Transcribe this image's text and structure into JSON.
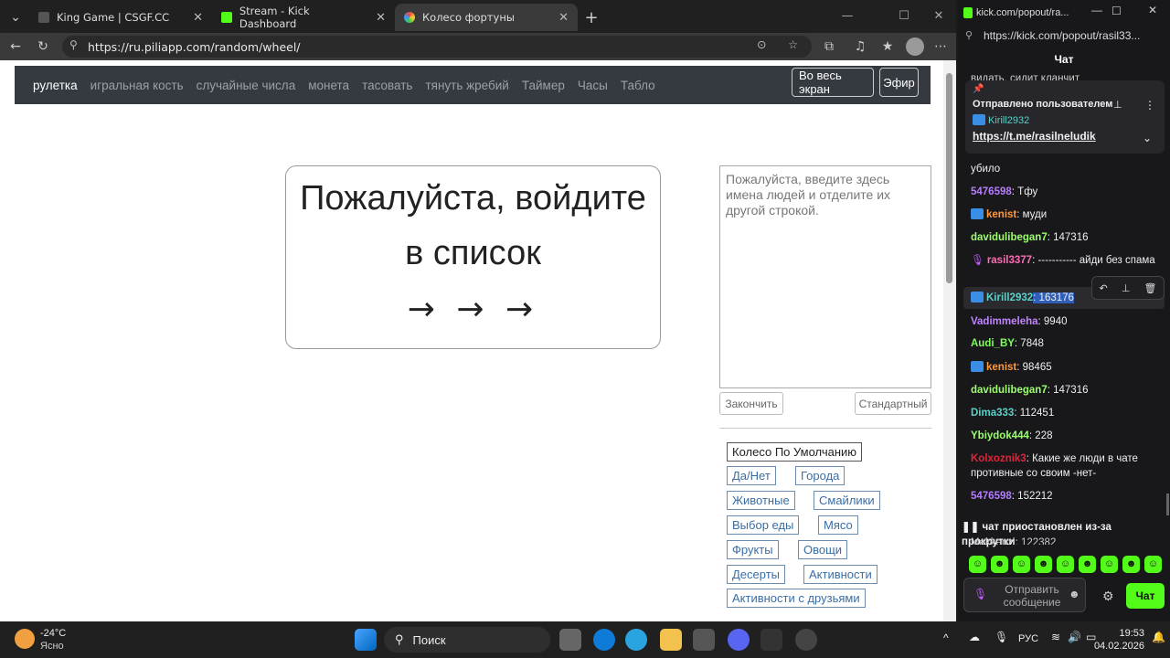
{
  "browser": {
    "tabs": [
      {
        "title": "King Game | CSGF.CC"
      },
      {
        "title": "Stream - Kick Dashboard"
      },
      {
        "title": "Колесо фортуны"
      }
    ],
    "url": "https://ru.piliapp.com/random/wheel/"
  },
  "site": {
    "nav": [
      "рулетка",
      "игральная кость",
      "случайные числа",
      "монета",
      "тасовать",
      "тянуть жребий",
      "Таймер",
      "Часы",
      "Табло"
    ],
    "fullscreen_button": "Во весь экран",
    "live_button": "Эфир",
    "wheel_line1": "Пожалуйста, войдите",
    "wheel_line2": "в список",
    "wheel_arrows": "→ → →",
    "textarea_placeholder": "Пожалуйста, введите здесь имена людей и отделите их другой строкой.",
    "finish_button": "Закончить",
    "standard_button": "Стандартный",
    "presets": [
      "Колесо По Умолчанию",
      "Да/Нет",
      "Города",
      "Животные",
      "Смайлики",
      "Выбор еды",
      "Мясо",
      "Фрукты",
      "Овощи",
      "Десерты",
      "Активности",
      "Активности с друзьями"
    ]
  },
  "chat": {
    "window_title": "kick.com/popout/ra...",
    "window_url": "https://kick.com/popout/rasil33...",
    "header": "Чат",
    "top_cut": "видать, сидит кланчит",
    "pinned_label": "Отправлено пользователем",
    "pinned_user": "Kirill2932",
    "pinned_link": "https://t.me/rasilneludik",
    "messages": [
      {
        "user": "",
        "text": "убило",
        "color": "#efeff1"
      },
      {
        "user": "5476598",
        "text": ": Тфу",
        "color": "#b57cff"
      },
      {
        "user": "kenist",
        "text": ": муди",
        "color": "#ff9a3c"
      },
      {
        "user": "davidulibegan7",
        "text": ": 147316",
        "color": "#9bff6a"
      },
      {
        "user": "rasil3377",
        "text": ": ----------- айди без спама",
        "color": "#ff6bb5"
      },
      {
        "user": "Kirill2932",
        "text": ": 163176",
        "color": "#5ad1c9"
      },
      {
        "user": "Vadimmeleha",
        "text": ": 9940",
        "color": "#c084fc"
      },
      {
        "user": "Audi_BY",
        "text": ": 7848",
        "color": "#7dff5a"
      },
      {
        "user": "kenist",
        "text": ": 98465",
        "color": "#ff9a3c"
      },
      {
        "user": "davidulibegan7",
        "text": ": 147316",
        "color": "#9bff6a"
      },
      {
        "user": "Dima333",
        "text": ": 112451",
        "color": "#5ad1c9"
      },
      {
        "user": "Ybiydok444",
        "text": ": 228",
        "color": "#9bff6a"
      },
      {
        "user": "Kolxoznik3",
        "text": ": Какие же люди в чате противные со своим -нет-",
        "color": "#e0243a"
      },
      {
        "user": "5476598",
        "text": ": 152212",
        "color": "#b57cff"
      }
    ],
    "paused": "чат приостановлен из-за прокрутки",
    "bottom_cut": "Makkenzi: 122382",
    "send_placeholder": "Отправить сообщение",
    "chat_button": "Чат"
  },
  "taskbar": {
    "weather_temp": "-24°C",
    "weather_text": "Ясно",
    "search": "Поиск",
    "lang": "РУС",
    "time": "19:53",
    "date": "04.02.2026"
  }
}
